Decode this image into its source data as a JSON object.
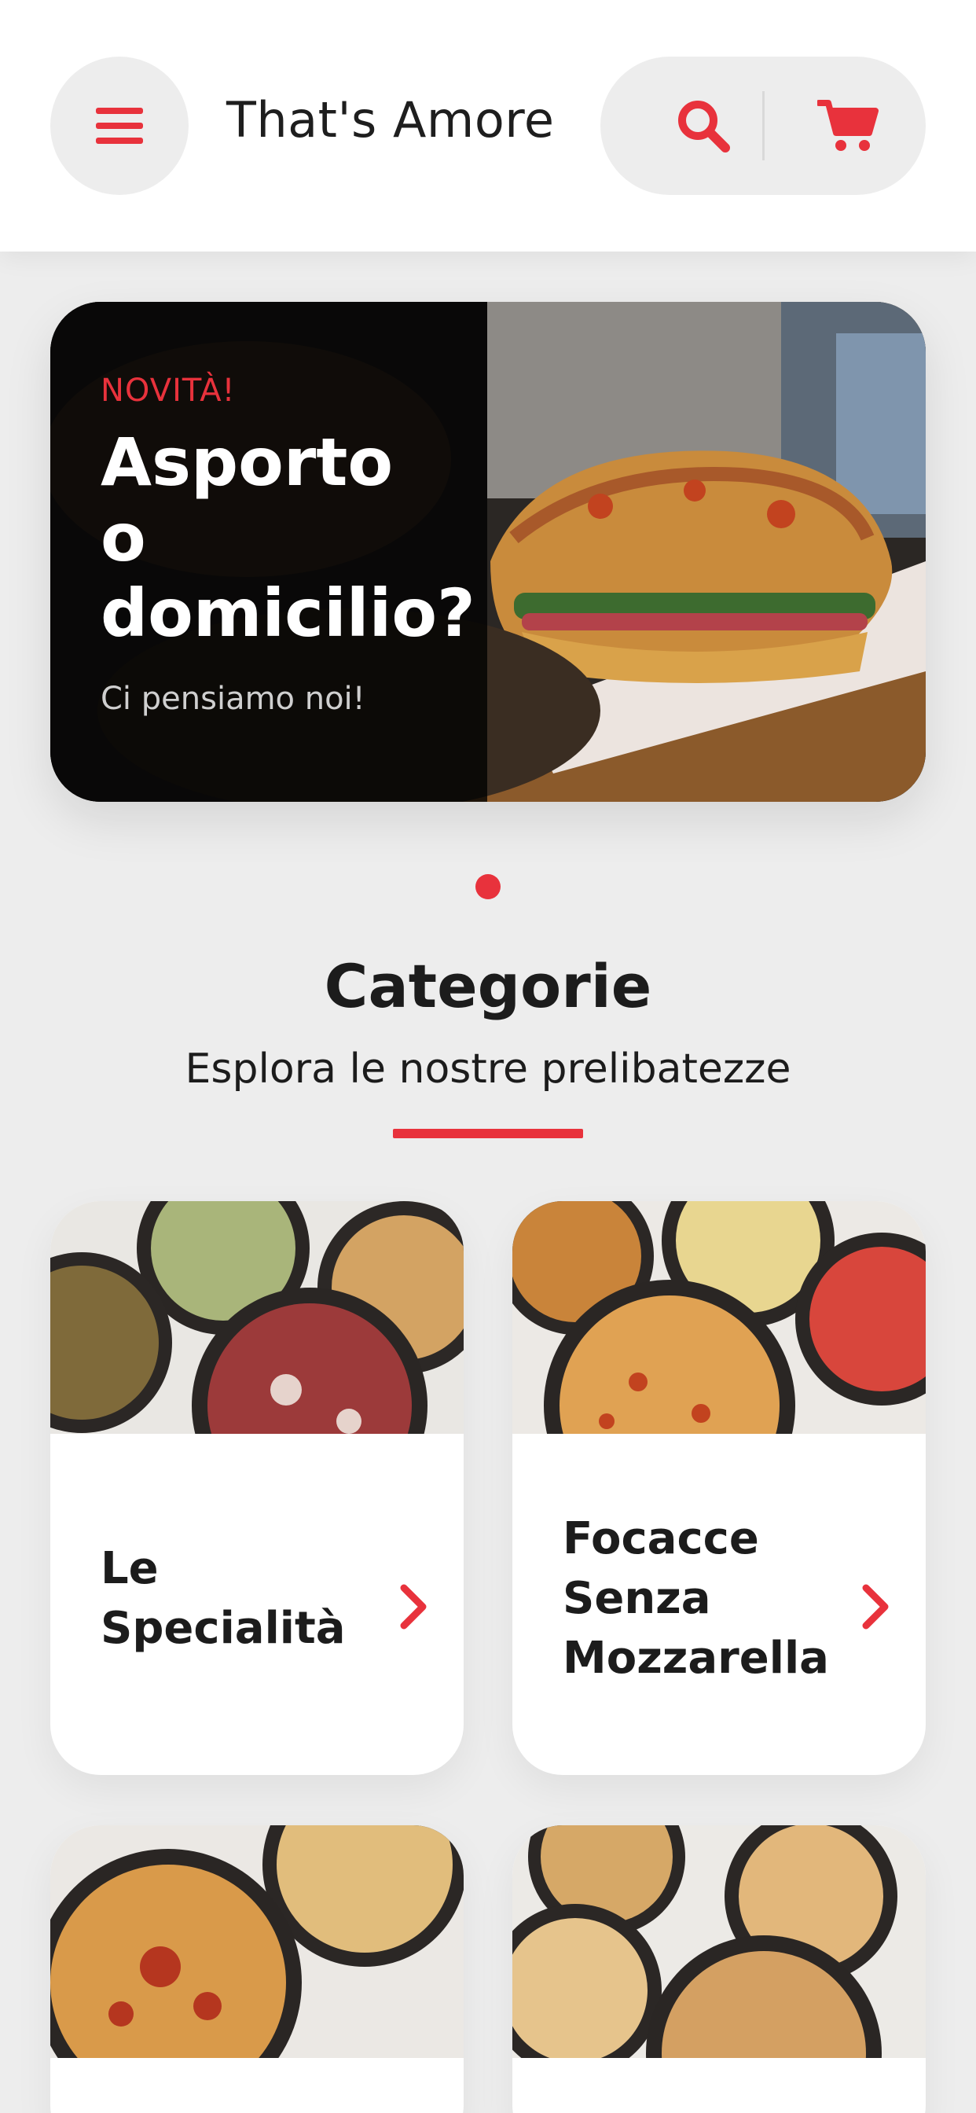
{
  "header": {
    "title": "That's Amore",
    "menu_icon": "hamburger-menu-icon",
    "search_icon": "search-icon",
    "cart_icon": "cart-icon"
  },
  "banner": {
    "kicker": "NOVITÀ!",
    "title_lines": [
      "Asporto",
      "o",
      "domicilio?"
    ],
    "subtitle": "Ci pensiamo noi!"
  },
  "carousel": {
    "pages": 1,
    "active": 1
  },
  "section": {
    "title": "Categorie",
    "subtitle": "Esplora le nostre prelibatezze"
  },
  "categories": [
    {
      "label": "Le Specialità"
    },
    {
      "label": "Focacce Senza Mozzarella"
    },
    {
      "label": ""
    },
    {
      "label": ""
    }
  ],
  "colors": {
    "accent": "#e8323c",
    "background": "#ededed",
    "surface": "#ffffff",
    "text": "#1c1c1c"
  }
}
